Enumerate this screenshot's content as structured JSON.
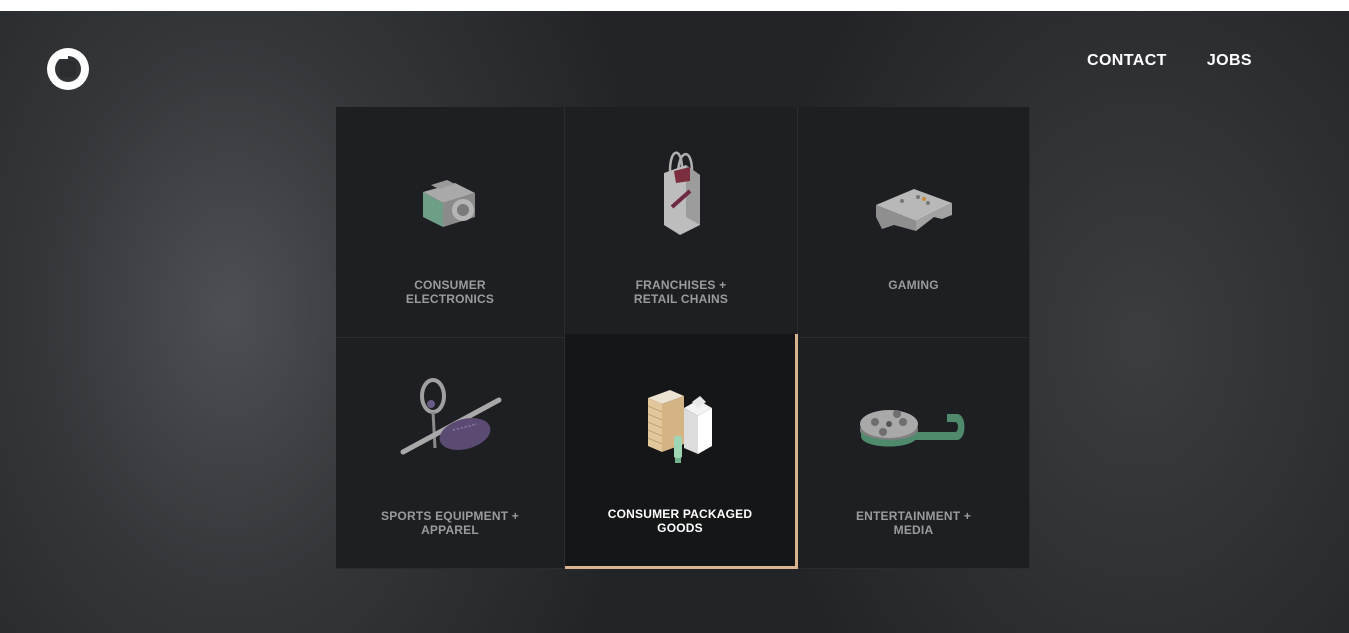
{
  "nav": {
    "contact": "CONTACT",
    "jobs": "JOBS"
  },
  "tiles": [
    {
      "label": "CONSUMER\nELECTRONICS",
      "icon": "camera-icon"
    },
    {
      "label": "FRANCHISES +\nRETAIL CHAINS",
      "icon": "shopping-bag-icon"
    },
    {
      "label": "GAMING",
      "icon": "game-controller-icon"
    },
    {
      "label": "SPORTS EQUIPMENT +\nAPPAREL",
      "icon": "sports-equipment-icon"
    },
    {
      "label": "CONSUMER PACKAGED\nGOODS",
      "icon": "packaged-goods-icon"
    },
    {
      "label": "ENTERTAINMENT +\nMEDIA",
      "icon": "film-reel-icon"
    }
  ],
  "colors": {
    "accent": "#d8b48c",
    "background": "#222427",
    "tile": "#1e1f22",
    "tile_active": "#151617"
  }
}
